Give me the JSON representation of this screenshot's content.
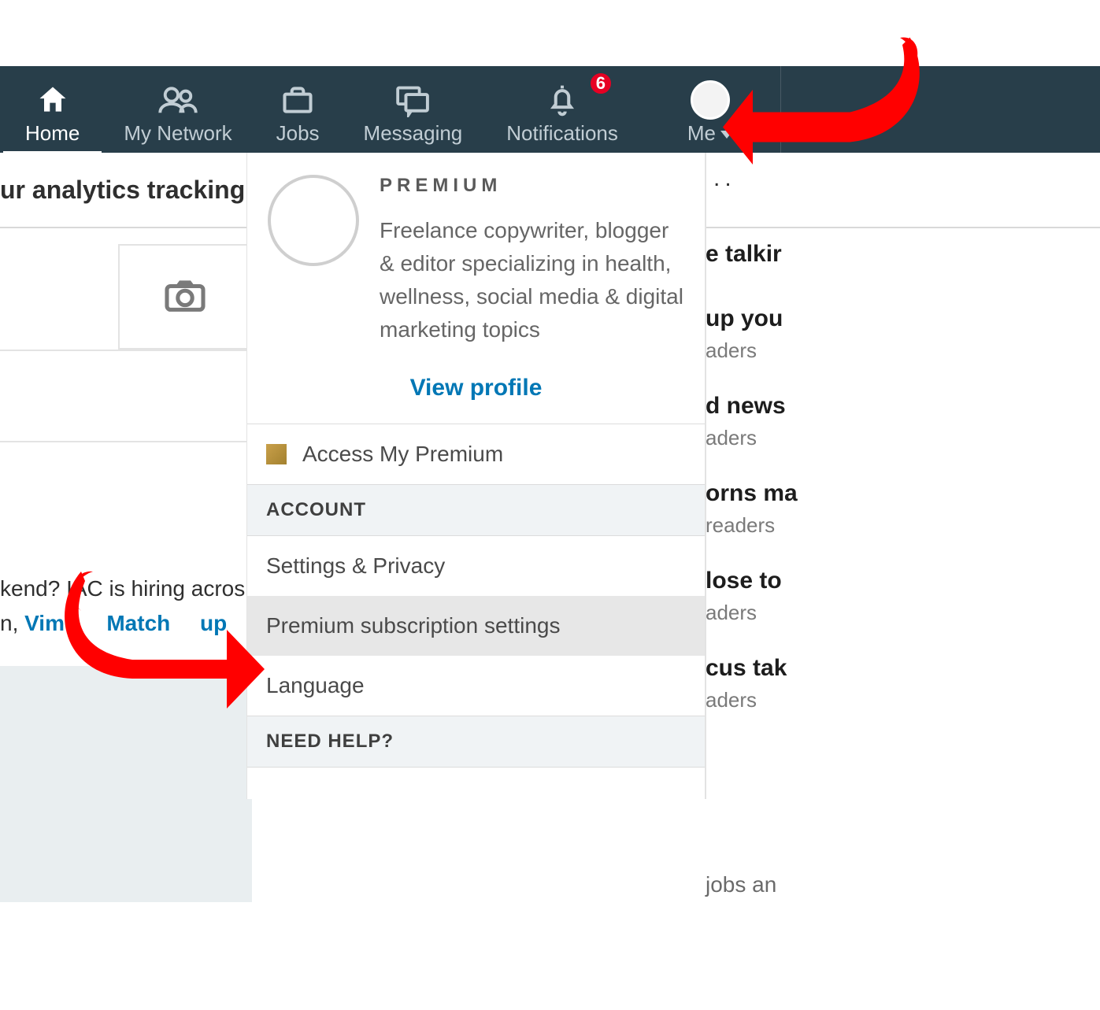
{
  "nav": {
    "home": {
      "label": "Home"
    },
    "network": {
      "label": "My Network"
    },
    "jobs": {
      "label": "Jobs"
    },
    "messaging": {
      "label": "Messaging"
    },
    "notifications": {
      "label": "Notifications",
      "badge": "6"
    },
    "me": {
      "label": "Me"
    }
  },
  "subbar": {
    "text": "ur analytics tracking,"
  },
  "subbar_dots": "..",
  "dropdown": {
    "premium_label": "PREMIUM",
    "description": "Freelance copywriter, blogger & editor specializing in health, wellness, social media & digital marketing topics",
    "view_profile": "View profile",
    "access_premium": "Access My Premium",
    "section_account": "ACCOUNT",
    "settings_privacy": "Settings & Privacy",
    "premium_sub": "Premium subscription settings",
    "language": "Language",
    "section_help": "NEED HELP?"
  },
  "feed": {
    "line1_prefix": "kend? IAC is hiring acros",
    "line2_prefix": "n, ",
    "line2_link": "Vime",
    "line2_mid": "Match",
    "line2_suffix": "up"
  },
  "right": {
    "items": [
      {
        "headline": "e talkir",
        "readers": ""
      },
      {
        "headline": "up you",
        "readers": "aders"
      },
      {
        "headline": "d news",
        "readers": "aders"
      },
      {
        "headline": "orns ma",
        "readers": " readers"
      },
      {
        "headline": "lose to",
        "readers": "aders"
      },
      {
        "headline": "cus tak",
        "readers": "aders"
      }
    ],
    "footer": " jobs an"
  }
}
